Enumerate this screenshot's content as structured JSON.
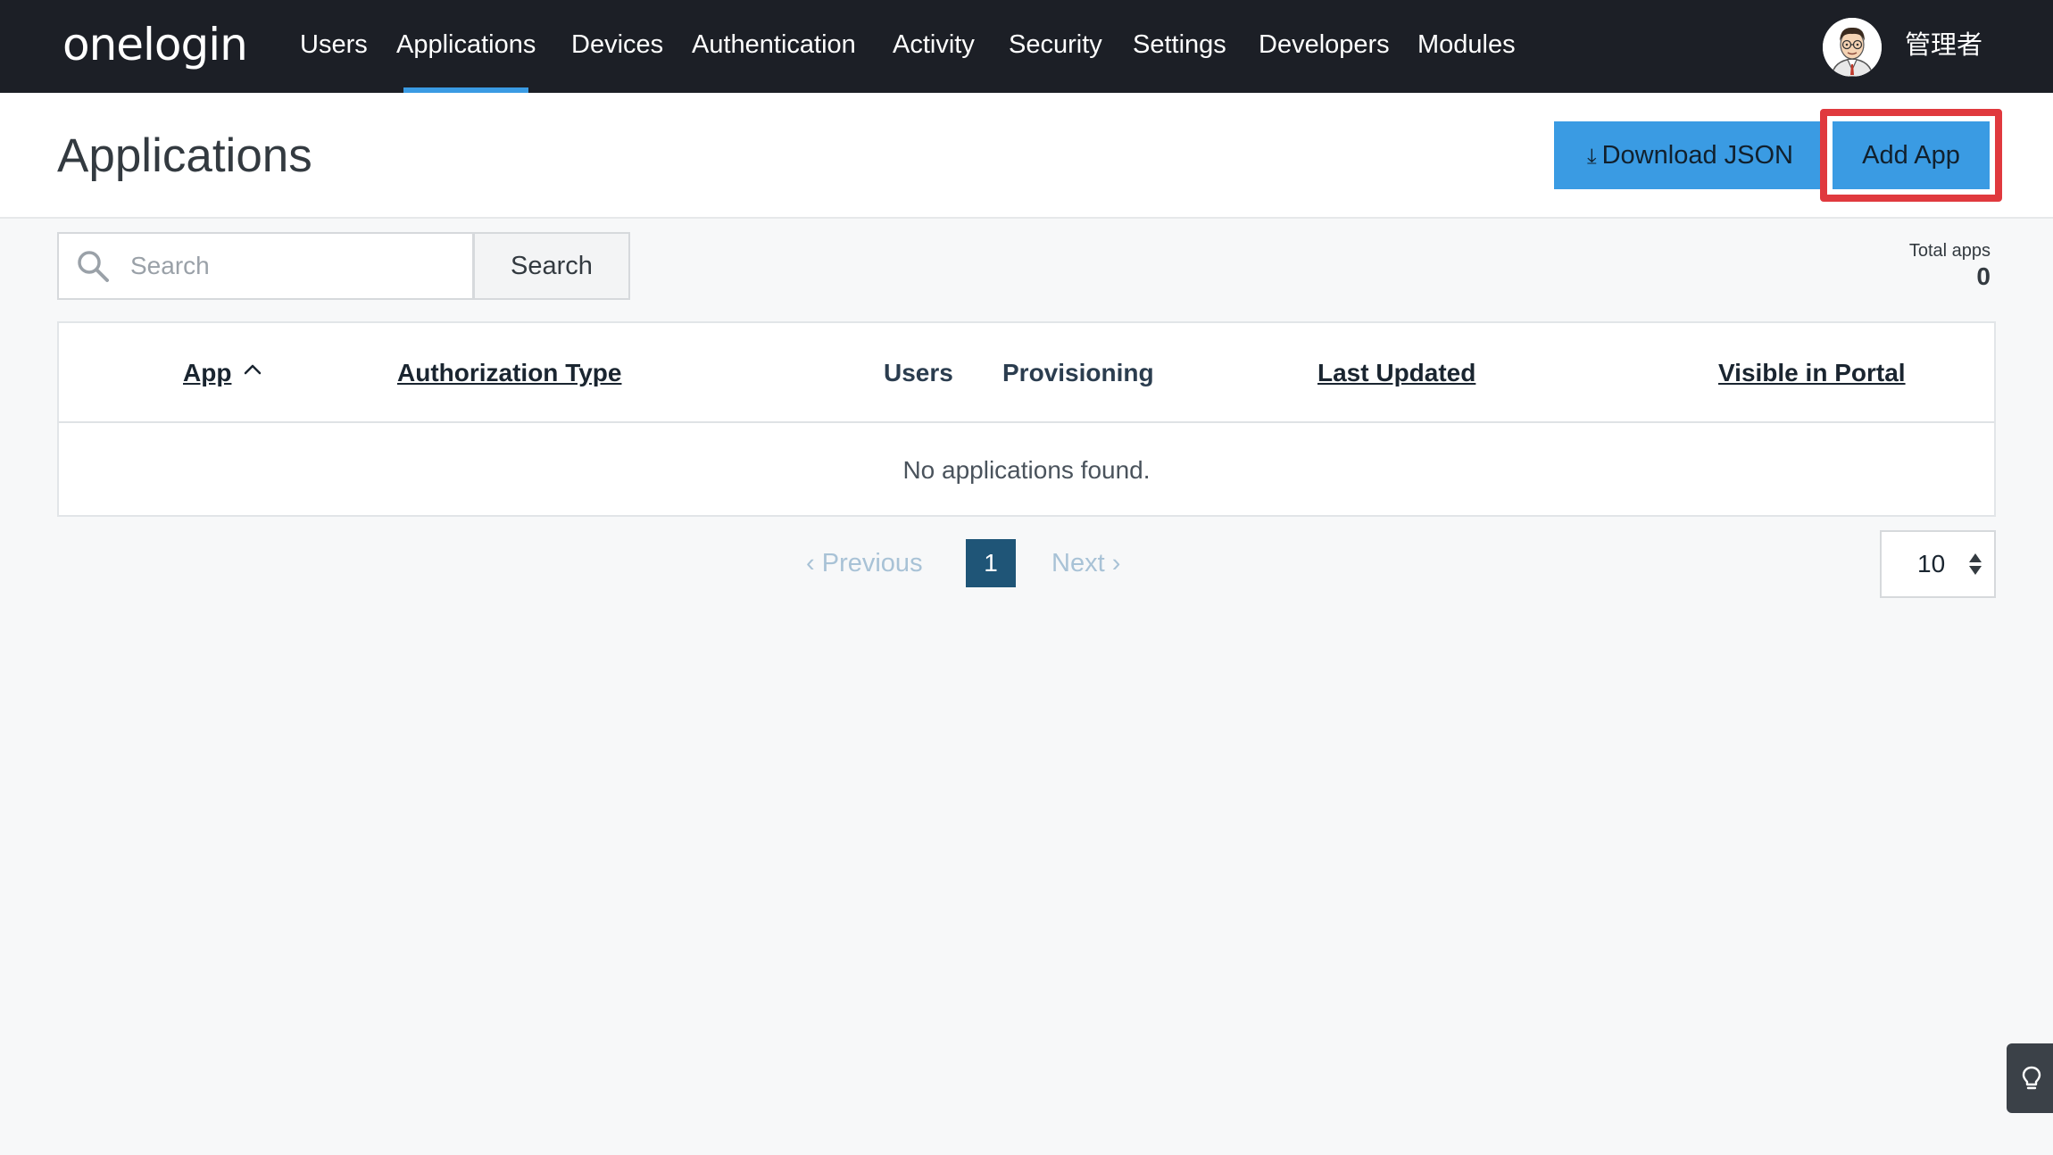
{
  "app": {
    "logo": "onelogin"
  },
  "nav": {
    "items": [
      {
        "label": "Users"
      },
      {
        "label": "Applications"
      },
      {
        "label": "Devices"
      },
      {
        "label": "Authentication"
      },
      {
        "label": "Activity"
      },
      {
        "label": "Security"
      },
      {
        "label": "Settings"
      },
      {
        "label": "Developers"
      },
      {
        "label": "Modules"
      }
    ],
    "active_item": "Applications",
    "user_name": "管理者"
  },
  "header": {
    "title": "Applications",
    "download_label": "Download JSON",
    "download_icon": "download-icon",
    "add_label": "Add App",
    "add_highlight_color": "#e0393e"
  },
  "search": {
    "placeholder": "Search",
    "value": "",
    "button_label": "Search"
  },
  "summary": {
    "total_label": "Total apps",
    "total_value": "0"
  },
  "table": {
    "columns": [
      {
        "label": "App",
        "sortable": true,
        "sort": "ascending"
      },
      {
        "label": "Authorization Type",
        "sortable": true
      },
      {
        "label": "Users",
        "sortable": false
      },
      {
        "label": "Provisioning",
        "sortable": false
      },
      {
        "label": "Last Updated",
        "sortable": true
      },
      {
        "label": "Visible in Portal",
        "sortable": true
      }
    ],
    "rows": [],
    "empty_message": "No applications found."
  },
  "pagination": {
    "previous_label": "Previous",
    "next_label": "Next",
    "current_page": "1",
    "per_page": "10"
  },
  "colors": {
    "nav_bg": "#1c1f26",
    "accent": "#3a9be3",
    "page_active": "#1f5577"
  },
  "tips_button": {
    "icon": "lightbulb-icon"
  }
}
